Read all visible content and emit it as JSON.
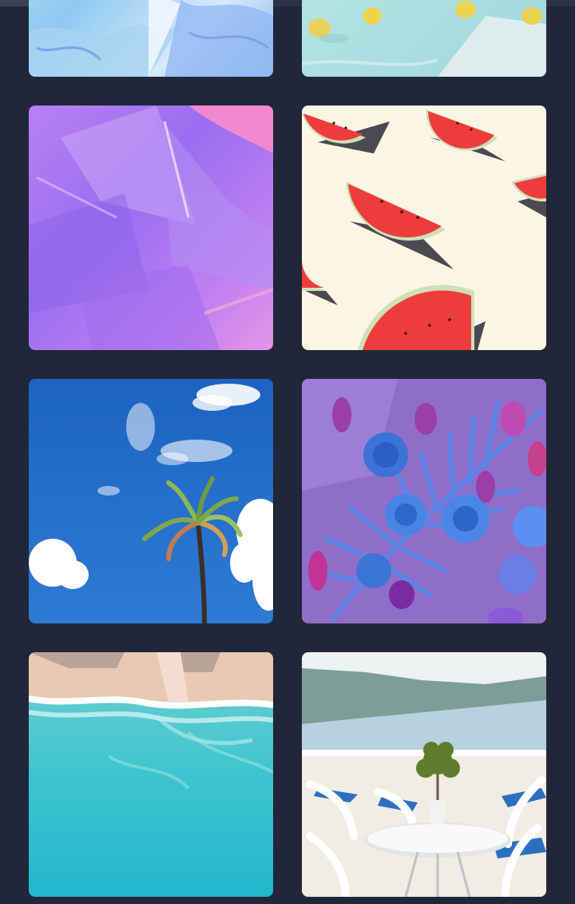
{
  "scroll_progress": 0.33,
  "gallery": {
    "images": [
      {
        "name": "holographic-foil-image"
      },
      {
        "name": "lemons-in-pool-image"
      },
      {
        "name": "iridescent-plastic-image"
      },
      {
        "name": "watermelon-slices-image"
      },
      {
        "name": "palm-tree-sky-image"
      },
      {
        "name": "blue-flowers-palm-image"
      },
      {
        "name": "turquoise-beach-image"
      },
      {
        "name": "santorini-balcony-image"
      }
    ]
  },
  "colors": {
    "background": "#202738",
    "scrollbar_track": "#2a3244",
    "scrollbar_thumb": "#3a4254"
  }
}
